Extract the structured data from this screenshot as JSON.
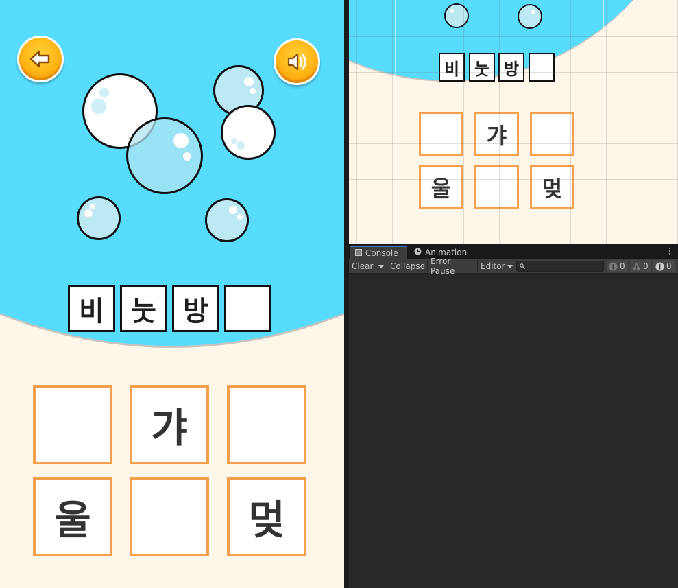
{
  "game": {
    "back_icon": "back-arrow-icon",
    "sound_icon": "speaker-icon",
    "word_tiles": [
      "비",
      "눗",
      "방",
      ""
    ],
    "answer_grid": [
      [
        "",
        "갸",
        ""
      ],
      [
        "울",
        "",
        "멎"
      ]
    ],
    "colors": {
      "sky": "#58dcfd",
      "ground": "#fff6ea",
      "button": "#ffb415",
      "tile_border": "#f6a04e"
    }
  },
  "scene_view": {
    "word_tiles": [
      "비",
      "눗",
      "방",
      ""
    ],
    "answer_grid": [
      [
        "",
        "갸",
        ""
      ],
      [
        "울",
        "",
        "멎"
      ]
    ]
  },
  "console_panel": {
    "tabs": [
      {
        "label": "Console",
        "icon": "console-icon",
        "active": true
      },
      {
        "label": "Animation",
        "icon": "clock-icon",
        "active": false
      }
    ],
    "toolbar": {
      "clear": "Clear",
      "collapse": "Collapse",
      "error_pause": "Error Pause",
      "editor": "Editor",
      "search_placeholder": ""
    },
    "counts": {
      "info": "0",
      "warnings": "0",
      "errors": "0"
    },
    "colors": {
      "background": "#282828",
      "toolbar": "#3c3c3c",
      "accent": "#3a79bb"
    }
  }
}
